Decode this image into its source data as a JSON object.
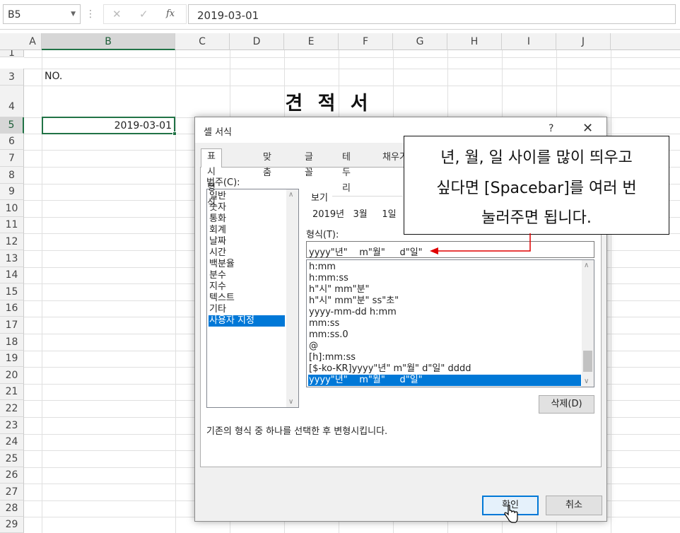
{
  "formula_bar": {
    "name_box": "B5",
    "separator": "⋮",
    "cancel_icon": "✕",
    "enter_icon": "✓",
    "fx_label": "fx",
    "value": "2019-03-01"
  },
  "grid": {
    "columns": [
      "A",
      "B",
      "C",
      "D",
      "E",
      "F",
      "G",
      "H",
      "I",
      "J"
    ],
    "selected_column": "B",
    "rows": [
      "1",
      "3",
      "4",
      "5",
      "6",
      "7",
      "8",
      "9",
      "10",
      "11",
      "12",
      "13",
      "14",
      "15",
      "16",
      "17",
      "18",
      "19",
      "20",
      "21",
      "22",
      "23",
      "24",
      "25",
      "26",
      "27",
      "28",
      "29"
    ],
    "selected_row": "5",
    "cells": {
      "a3_b3": "NO.",
      "title": "견 적 서",
      "b5": "2019-03-01"
    }
  },
  "dialog": {
    "title": "셀 서식",
    "help": "?",
    "close": "✕",
    "tabs": [
      "표시 형식",
      "맞춤",
      "글꼴",
      "테두리",
      "채우기"
    ],
    "active_tab": "표시 형식",
    "category_label": "범주(C):",
    "categories": [
      "일반",
      "숫자",
      "통화",
      "회계",
      "날짜",
      "시간",
      "백분율",
      "분수",
      "지수",
      "텍스트",
      "기타",
      "사용자 지정"
    ],
    "selected_category": "사용자 지정",
    "sample_label": "보기",
    "sample_value": "2019년   3월     1일",
    "format_label": "형식(T):",
    "format_value": "yyyy\"년\"    m\"월\"     d\"일\"",
    "format_list": [
      "h:mm",
      "h:mm:ss",
      "h\"시\" mm\"분\"",
      "h\"시\" mm\"분\" ss\"초\"",
      "yyyy-mm-dd h:mm",
      "mm:ss",
      "mm:ss.0",
      "@",
      "[h]:mm:ss",
      "[$-ko-KR]yyyy\"년\" m\"월\" d\"일\" dddd",
      "yyyy\"년\"    m\"월\"     d\"일\""
    ],
    "selected_format_index": 10,
    "delete_button": "삭제(D)",
    "description": "기존의 형식 중 하나를 선택한 후 변형시킵니다.",
    "ok_button": "확인",
    "cancel_button": "취소"
  },
  "callout": {
    "line1": "년, 월, 일 사이를 많이 띄우고",
    "line2": "싶다면 [Spacebar]를 여러 번",
    "line3": "눌러주면 됩니다.",
    "arrow_color": "#e00000"
  },
  "colors": {
    "excel_green": "#217346",
    "selection_blue": "#0078d7"
  }
}
